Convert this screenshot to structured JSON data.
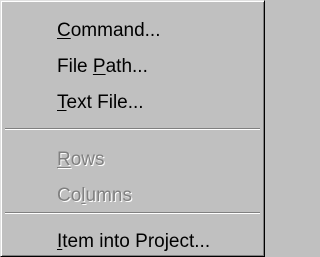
{
  "menu": {
    "items": [
      {
        "pre": "",
        "key": "C",
        "post": "ommand...",
        "enabled": true
      },
      {
        "pre": "File ",
        "key": "P",
        "post": "ath...",
        "enabled": true
      },
      {
        "pre": "",
        "key": "T",
        "post": "ext File...",
        "enabled": true
      },
      {
        "pre": "",
        "key": "R",
        "post": "ows",
        "enabled": false
      },
      {
        "pre": "Co",
        "key": "l",
        "post": "umns",
        "enabled": false
      },
      {
        "pre": "",
        "key": "I",
        "post": "tem into Project...",
        "enabled": true
      }
    ]
  }
}
